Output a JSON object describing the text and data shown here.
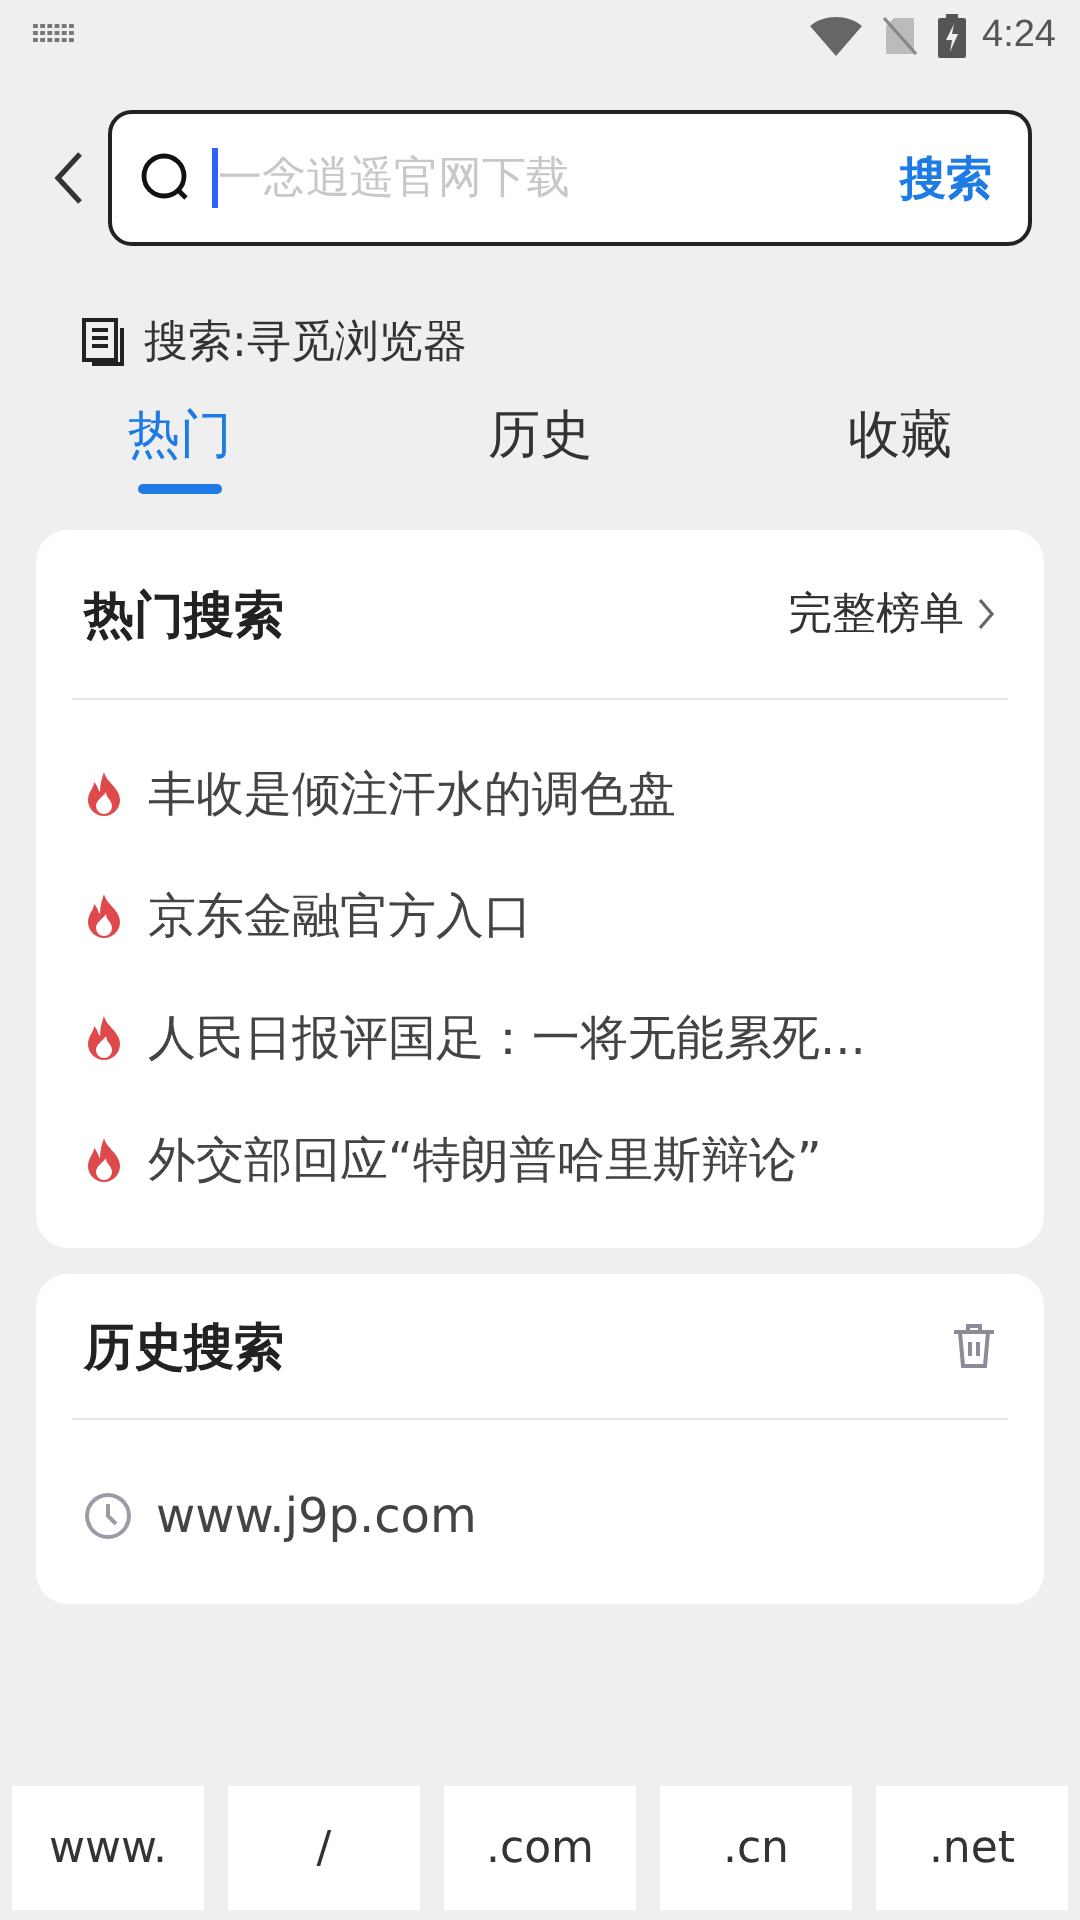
{
  "status_bar": {
    "time": "4:24"
  },
  "search": {
    "placeholder": "一念逍遥官网下载",
    "button": "搜索"
  },
  "suggestion": {
    "label": "搜索:寻觅浏览器"
  },
  "tabs": [
    {
      "label": "热门",
      "selected": true
    },
    {
      "label": "历史",
      "selected": false
    },
    {
      "label": "收藏",
      "selected": false
    }
  ],
  "hot_searches": {
    "title": "热门搜索",
    "link": "完整榜单",
    "items": [
      "丰收是倾注汗水的调色盘",
      "京东金融官方入口",
      "人民日报评国足：一将无能累死...",
      "外交部回应“特朗普哈里斯辩论”"
    ]
  },
  "history": {
    "title": "历史搜索",
    "items": [
      "www.j9p.com"
    ]
  },
  "quick_keys": [
    "www.",
    "/",
    ".com",
    ".cn",
    ".net"
  ]
}
